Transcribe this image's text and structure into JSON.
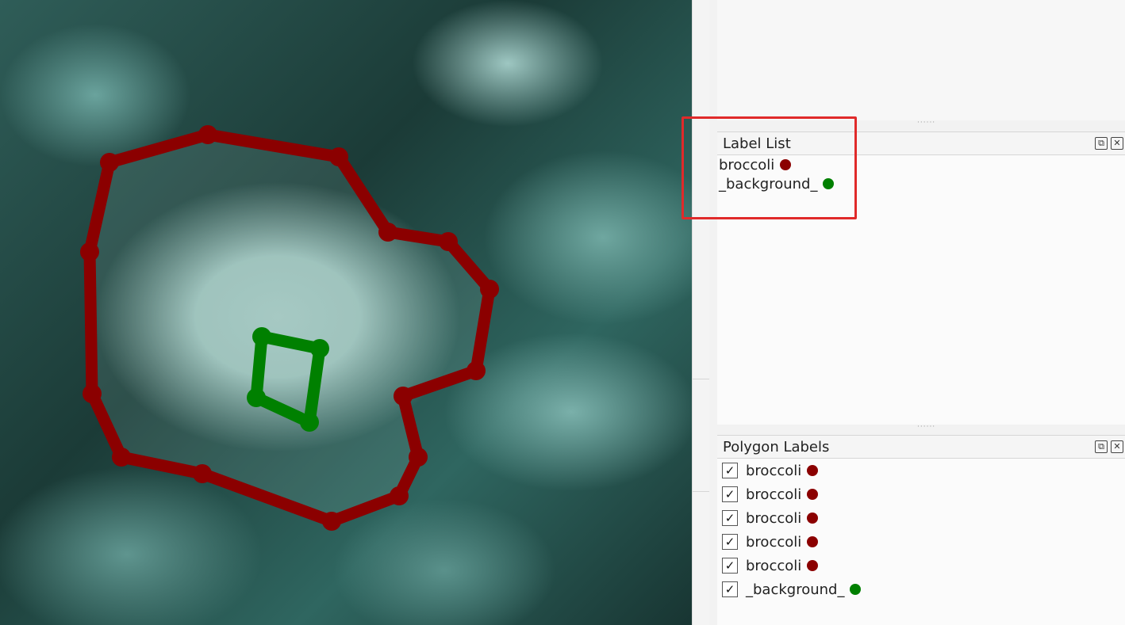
{
  "canvas": {
    "polygons": [
      {
        "label": "broccoli",
        "color": "#8b0000"
      },
      {
        "label": "_background_",
        "color": "#008000"
      }
    ]
  },
  "label_list": {
    "title": "Label List",
    "items": [
      {
        "label": "broccoli",
        "color": "#8b0000"
      },
      {
        "label": "_background_",
        "color": "#008000"
      }
    ]
  },
  "polygon_labels": {
    "title": "Polygon Labels",
    "items": [
      {
        "label": "broccoli",
        "checked": true,
        "color": "#8b0000"
      },
      {
        "label": "broccoli",
        "checked": true,
        "color": "#8b0000"
      },
      {
        "label": "broccoli",
        "checked": true,
        "color": "#8b0000"
      },
      {
        "label": "broccoli",
        "checked": true,
        "color": "#8b0000"
      },
      {
        "label": "broccoli",
        "checked": true,
        "color": "#8b0000"
      },
      {
        "label": "_background_",
        "checked": true,
        "color": "#008000"
      }
    ]
  },
  "icons": {
    "float": "float-icon",
    "close": "close-icon",
    "check": "check-icon"
  },
  "highlight_color": "#e02a2a"
}
